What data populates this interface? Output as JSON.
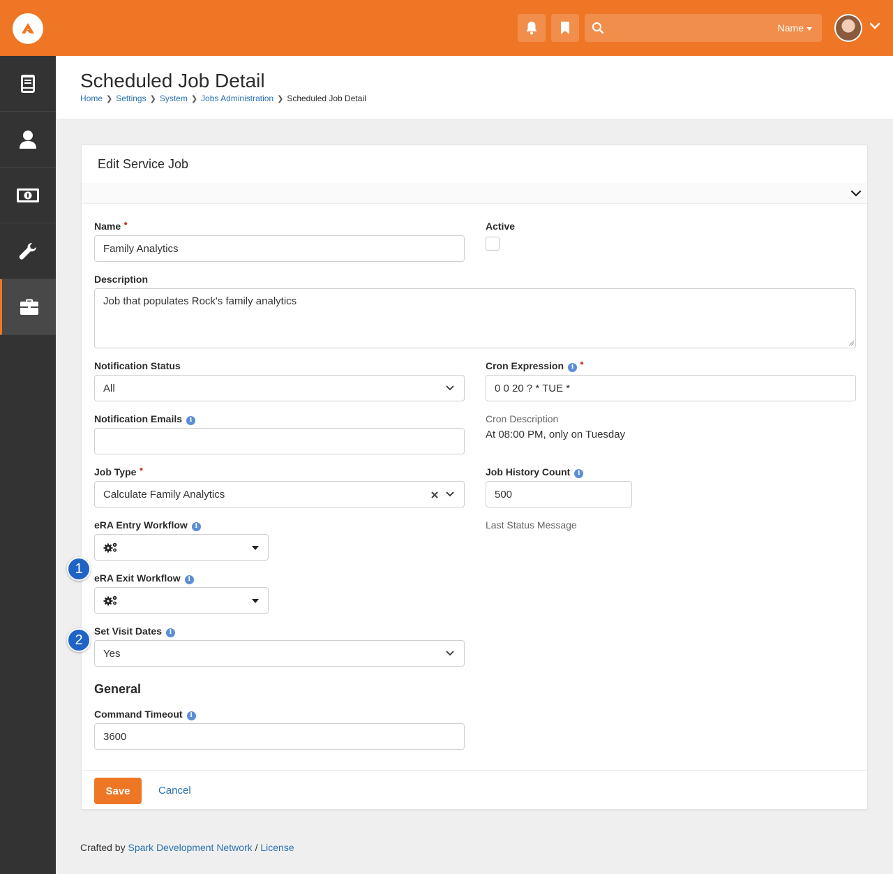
{
  "colors": {
    "brand": "#ee7624",
    "link": "#2a72b5",
    "callout": "#1f63c7",
    "sidebar": "#333333"
  },
  "header": {
    "search_scope": "Name"
  },
  "sidebar": {
    "items": [
      {
        "icon": "book-icon"
      },
      {
        "icon": "person-icon"
      },
      {
        "icon": "money-icon"
      },
      {
        "icon": "wrench-icon"
      },
      {
        "icon": "briefcase-icon",
        "active": true
      }
    ]
  },
  "page": {
    "title": "Scheduled Job Detail",
    "breadcrumb": [
      "Home",
      "Settings",
      "System",
      "Jobs Administration",
      "Scheduled Job Detail"
    ]
  },
  "panel": {
    "title": "Edit Service Job"
  },
  "form": {
    "name_label": "Name",
    "name_value": "Family Analytics",
    "active_label": "Active",
    "description_label": "Description",
    "description_value": "Job that populates Rock's family analytics",
    "notification_status_label": "Notification Status",
    "notification_status_value": "All",
    "cron_expression_label": "Cron Expression",
    "cron_expression_value": "0 0 20 ? * TUE *",
    "notification_emails_label": "Notification Emails",
    "notification_emails_value": "",
    "cron_description_label": "Cron Description",
    "cron_description_value": "At 08:00 PM, only on Tuesday",
    "job_type_label": "Job Type",
    "job_type_value": "Calculate Family Analytics",
    "job_history_count_label": "Job History Count",
    "job_history_count_value": "500",
    "last_status_message_label": "Last Status Message",
    "era_entry_workflow_label": "eRA Entry Workflow",
    "era_exit_workflow_label": "eRA Exit Workflow",
    "set_visit_dates_label": "Set Visit Dates",
    "set_visit_dates_value": "Yes",
    "general_section_title": "General",
    "command_timeout_label": "Command Timeout",
    "command_timeout_value": "3600"
  },
  "actions": {
    "save_label": "Save",
    "cancel_label": "Cancel"
  },
  "callouts": [
    "1",
    "2"
  ],
  "footer": {
    "prefix": "Crafted by",
    "org": "Spark Development Network",
    "sep": "/",
    "license": "License"
  }
}
